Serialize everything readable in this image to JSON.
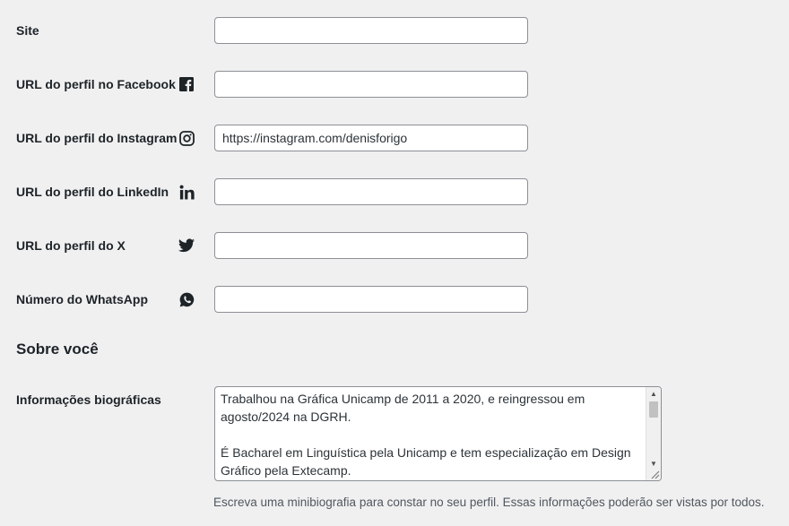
{
  "fields": [
    {
      "label": "Site",
      "icon": "",
      "value": ""
    },
    {
      "label": "URL do perfil no Facebook",
      "icon": "facebook-icon",
      "value": ""
    },
    {
      "label": "URL do perfil do Instagram",
      "icon": "instagram-icon",
      "value": "https://instagram.com/denisforigo"
    },
    {
      "label": "URL do perfil do LinkedIn",
      "icon": "linkedin-icon",
      "value": ""
    },
    {
      "label": "URL do perfil do X",
      "icon": "twitter-icon",
      "value": ""
    },
    {
      "label": "Número do WhatsApp",
      "icon": "whatsapp-icon",
      "value": ""
    }
  ],
  "about": {
    "title": "Sobre você",
    "bio_label": "Informações biográficas",
    "bio_text": "Trabalhou na Gráfica Unicamp de 2011 a 2020, e reingressou em agosto/2024 na DGRH.\n\nÉ Bacharel em Linguística pela Unicamp e tem especialização em Design Gráfico pela Extecamp.",
    "description": "Escreva uma minibiografia para constar no seu perfil. Essas informações poderão ser vistas por todos."
  }
}
